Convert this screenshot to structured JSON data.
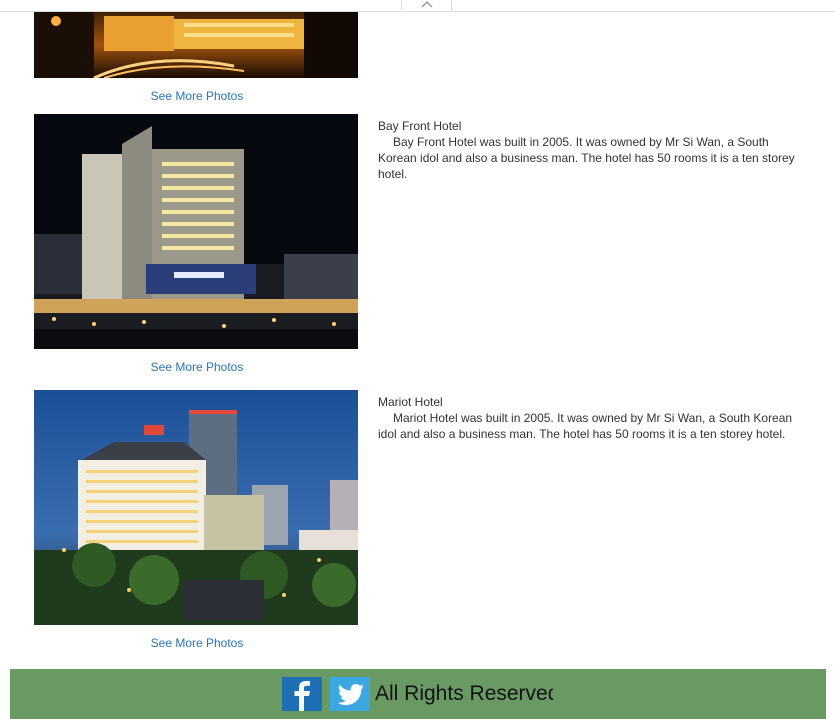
{
  "listing": {
    "see_more_label": "See More Photos",
    "hotels": [
      {
        "name": "Bay Front Hotel",
        "description": "Bay Front  Hotel was built in 2005. It was owned by Mr Si Wan, a South Korean idol and also a business man. The hotel has 50 rooms it is a ten storey hotel."
      },
      {
        "name": "Mariot Hotel",
        "description": "Mariot  Hotel was built in 2005. It was owned by Mr Si Wan, a South Korean idol and also a business man. The hotel has 50 rooms it is a ten storey hotel."
      }
    ]
  },
  "footer": {
    "rights_text": "All Rights Reserved",
    "facebook_icon": "facebook-icon",
    "twitter_icon": "twitter-icon"
  },
  "colors": {
    "link": "#2a74b5",
    "footer_bg": "#6a9a64",
    "facebook": "#1f6fb5",
    "twitter": "#3aa7e0"
  }
}
